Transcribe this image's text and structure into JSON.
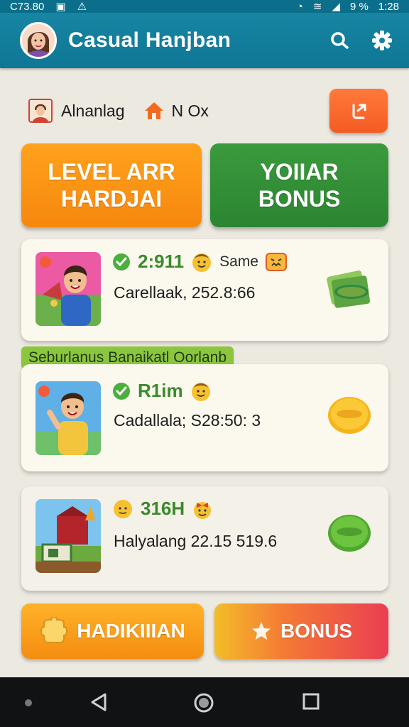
{
  "status_bar": {
    "time_left": "C73.80",
    "battery_percent": "9 %",
    "clock": "1:28"
  },
  "app_bar": {
    "title": "Casual Hanjban",
    "icons": [
      "search-icon",
      "settings-icon"
    ]
  },
  "info_row": {
    "user_label": "Alnanlag",
    "home_label": "N Ox",
    "share_icon": "share-icon"
  },
  "big_buttons": {
    "level": "LEVEL ARR\nHARDJAI",
    "bonus": "YOIIAR\nBONUS"
  },
  "cards": [
    {
      "stat": "2:911",
      "tag": "Same",
      "subtitle": "Carellaak, 252.8:66",
      "reward_icon": "cash-reward-icon"
    },
    {
      "stat": "R1im",
      "subtitle": "Cadallala;  S28:50: 3",
      "reward_icon": "gold-coin-icon"
    },
    {
      "stat": "316H",
      "subtitle": "Halyalang 22.15 519.6",
      "reward_icon": "green-gem-icon"
    }
  ],
  "section_banner": "Seburlanus Banaikatl Oorlanb",
  "bottom_buttons": {
    "left": "HADIKIIIAN",
    "right": "BONUS"
  },
  "colors": {
    "app_bar": "#1785a3",
    "orange": "#f7870f",
    "green": "#2b8531",
    "background": "#ece9e1"
  }
}
